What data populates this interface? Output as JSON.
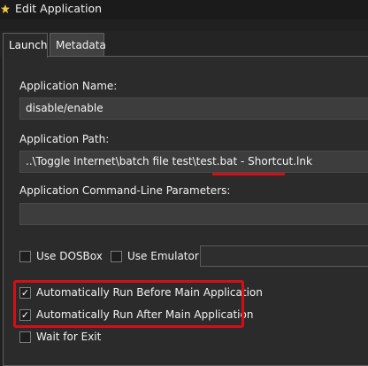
{
  "window": {
    "title": "Edit Application",
    "icon": "star-app-icon"
  },
  "tabs": [
    {
      "label": "Launch",
      "active": true
    },
    {
      "label": "Metadata",
      "active": false
    }
  ],
  "form": {
    "app_name": {
      "label": "Application Name:",
      "value": "disable/enable"
    },
    "app_path": {
      "label": "Application Path:",
      "value": "..\\Toggle Internet\\batch file test\\test.bat - Shortcut.lnk"
    },
    "cmd_params": {
      "label": "Application Command-Line Parameters:",
      "value": ""
    },
    "use_dosbox": {
      "label": "Use DOSBox",
      "checked": false
    },
    "use_emulator": {
      "label": "Use Emulator:",
      "checked": false,
      "value": ""
    },
    "run_before": {
      "label": "Automatically Run Before Main Application",
      "checked": true
    },
    "run_after": {
      "label": "Automatically Run After Main Application",
      "checked": true
    },
    "wait_for_exit": {
      "label": "Wait for Exit",
      "checked": false
    }
  },
  "annotation_color": "#d10f17"
}
